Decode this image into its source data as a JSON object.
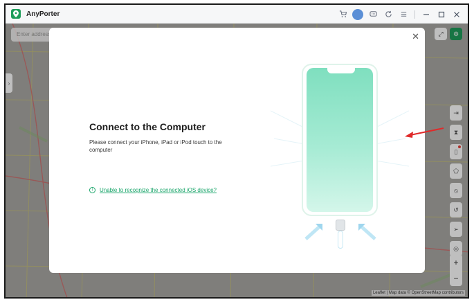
{
  "app": {
    "title": "AnyPorter"
  },
  "titlebar": {
    "icons": [
      "cart-icon",
      "avatar",
      "chat-icon",
      "refresh-icon",
      "menu-icon"
    ],
    "window_controls": [
      "minimize-icon",
      "maximize-icon",
      "close-icon"
    ]
  },
  "map": {
    "search_placeholder": "Enter address",
    "attribution": "Leaflet | Map data © OpenStreetMap contributors",
    "zoom_in": "+",
    "zoom_out": "−"
  },
  "dialog": {
    "title": "Connect to the Computer",
    "description": "Please connect your iPhone, iPad or iPod touch to the computer",
    "help_link": "Unable to recognize the connected iOS device?"
  },
  "colors": {
    "accent": "#19a56a",
    "brand": "#1f9d5b",
    "annotation_arrow": "#e02a2a"
  }
}
